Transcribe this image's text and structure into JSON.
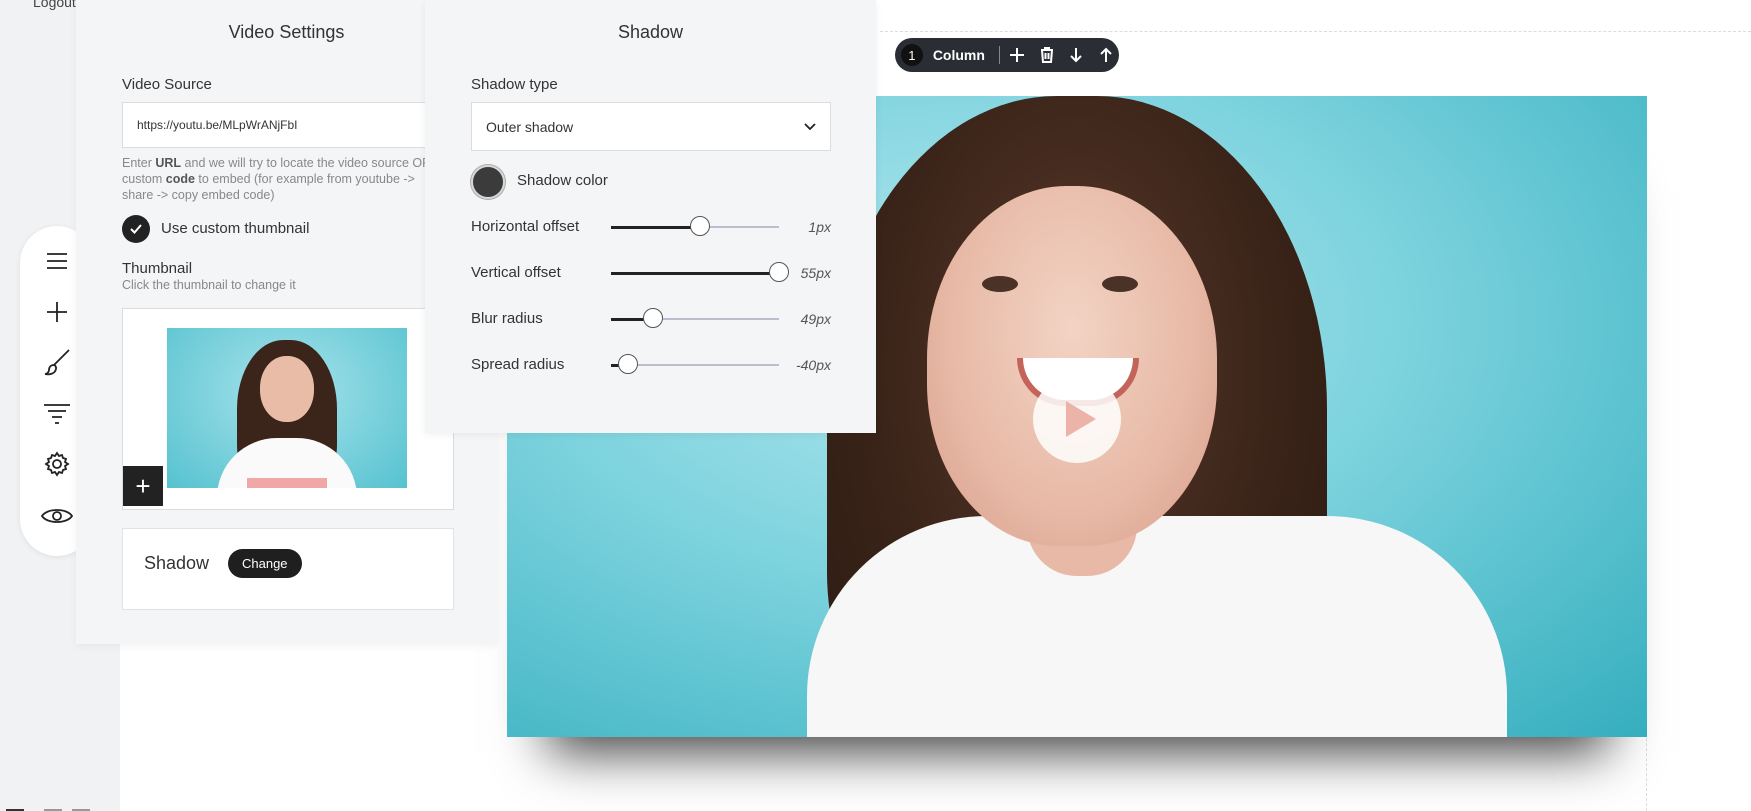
{
  "app": {
    "logout_label": "Logout"
  },
  "toolbar_rail": {
    "items": [
      {
        "name": "menu-icon"
      },
      {
        "name": "plus-icon"
      },
      {
        "name": "brush-icon"
      },
      {
        "name": "filter-icon"
      },
      {
        "name": "gear-icon"
      },
      {
        "name": "eye-icon"
      }
    ]
  },
  "column_bar": {
    "index": "1",
    "label": "Column",
    "actions": [
      "plus-icon",
      "trash-icon",
      "arrow-down-icon",
      "arrow-up-icon"
    ]
  },
  "video_settings": {
    "title": "Video Settings",
    "source_label": "Video Source",
    "source_value": "https://youtu.be/MLpWrANjFbI",
    "help_prefix": "Enter ",
    "help_url": "URL",
    "help_middle": " and we will try to locate the video source OR custom ",
    "help_code": "code",
    "help_suffix": " to embed (for example from youtube -> share -> copy embed code)",
    "use_custom_thumbnail_label": "Use custom thumbnail",
    "use_custom_thumbnail": true,
    "thumbnail_title": "Thumbnail",
    "thumbnail_sub": "Click the thumbnail to change it",
    "add_label": "+",
    "shadow_card_label": "Shadow",
    "change_label": "Change"
  },
  "shadow_panel": {
    "title": "Shadow",
    "type_label": "Shadow type",
    "type_value": "Outer shadow",
    "color_label": "Shadow color",
    "color_value": "#3b3b3b",
    "sliders": [
      {
        "label": "Horizontal offset",
        "value": "1px",
        "fraction": 0.53
      },
      {
        "label": "Vertical offset",
        "value": "55px",
        "fraction": 1.0
      },
      {
        "label": "Blur radius",
        "value": "49px",
        "fraction": 0.25
      },
      {
        "label": "Spread radius",
        "value": "-40px",
        "fraction": 0.1
      }
    ]
  },
  "colors": {
    "panel_bg": "#f4f5f7",
    "accent_dark": "#222222",
    "canvas_bg": "#6fcfdc"
  }
}
